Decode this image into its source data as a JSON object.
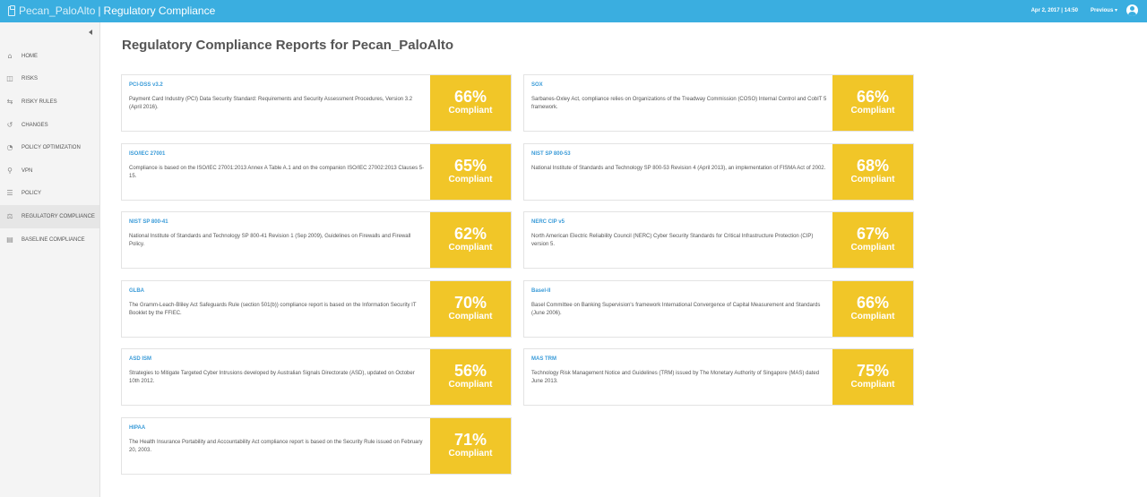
{
  "header": {
    "app_name": "Pecan_PaloAlto",
    "separator": "|",
    "section": "Regulatory Compliance",
    "date": "Apr 2, 2017 | 14:50",
    "previous": "Previous ▾"
  },
  "sidebar": {
    "items": [
      {
        "label": "HOME",
        "icon": "home-icon"
      },
      {
        "label": "RISKS",
        "icon": "shield-icon"
      },
      {
        "label": "RISKY RULES",
        "icon": "risky-rules-icon"
      },
      {
        "label": "CHANGES",
        "icon": "history-icon"
      },
      {
        "label": "POLICY OPTIMIZATION",
        "icon": "optimization-icon"
      },
      {
        "label": "VPN",
        "icon": "vpn-icon"
      },
      {
        "label": "POLICY",
        "icon": "list-icon"
      },
      {
        "label": "REGULATORY COMPLIANCE",
        "icon": "compliance-icon",
        "active": true
      },
      {
        "label": "BASELINE COMPLIANCE",
        "icon": "baseline-icon"
      }
    ]
  },
  "main": {
    "title": "Regulatory Compliance Reports for Pecan_PaloAlto",
    "compliant_label": "Compliant",
    "accent_color": "#f1c628",
    "reports": [
      {
        "name": "PCI-DSS v3.2",
        "desc": "Payment Card Industry (PCI) Data Security Standard: Requirements and Security Assessment Procedures, Version 3.2 (April 2016).",
        "percent": "66%"
      },
      {
        "name": "SOX",
        "desc": "Sarbanes-Oxley Act, compliance relies on Organizations of the Treadway Commission (COSO) Internal Control and CobIT 5 framework.",
        "percent": "66%"
      },
      {
        "name": "ISO/IEC 27001",
        "desc": "Compliance is based on the ISO/IEC 27001:2013 Annex A Table A.1 and on the companion ISO/IEC 27002:2013 Clauses 5-15.",
        "percent": "65%"
      },
      {
        "name": "NIST SP 800-53",
        "desc": "National Institute of Standards and Technology SP 800-53 Revision 4 (April 2013), an implementation of FISMA Act of 2002.",
        "percent": "68%"
      },
      {
        "name": "NIST SP 800-41",
        "desc": "National Institute of Standards and Technology SP 800-41 Revision 1 (Sep 2009), Guidelines on Firewalls and Firewall Policy.",
        "percent": "62%"
      },
      {
        "name": "NERC CIP v5",
        "desc": "North American Electric Reliability Council (NERC) Cyber Security Standards for Critical Infrastructure Protection (CIP) version 5.",
        "percent": "67%"
      },
      {
        "name": "GLBA",
        "desc": "The Gramm-Leach-Bliley Act Safeguards Rule (section 501(b)) compliance report is based on the Information Security IT Booklet by the FFIEC.",
        "percent": "70%"
      },
      {
        "name": "Basel-II",
        "desc": "Basel Committee on Banking Supervision's framework International Convergence of Capital Measurement and Standards (June 2006).",
        "percent": "66%"
      },
      {
        "name": "ASD ISM",
        "desc": "Strategies to Mitigate Targeted Cyber Intrusions developed by Australian Signals Directorate (ASD), updated on October 10th 2012.",
        "percent": "56%"
      },
      {
        "name": "MAS TRM",
        "desc": "Technology Risk Management Notice and Guidelines (TRM) issued by The Monetary Authority of Singapore (MAS) dated June 2013.",
        "percent": "75%"
      },
      {
        "name": "HIPAA",
        "desc": "The Health Insurance Portability and Accountability Act compliance report is based on the Security Rule issued on February 20, 2003.",
        "percent": "71%"
      }
    ]
  }
}
